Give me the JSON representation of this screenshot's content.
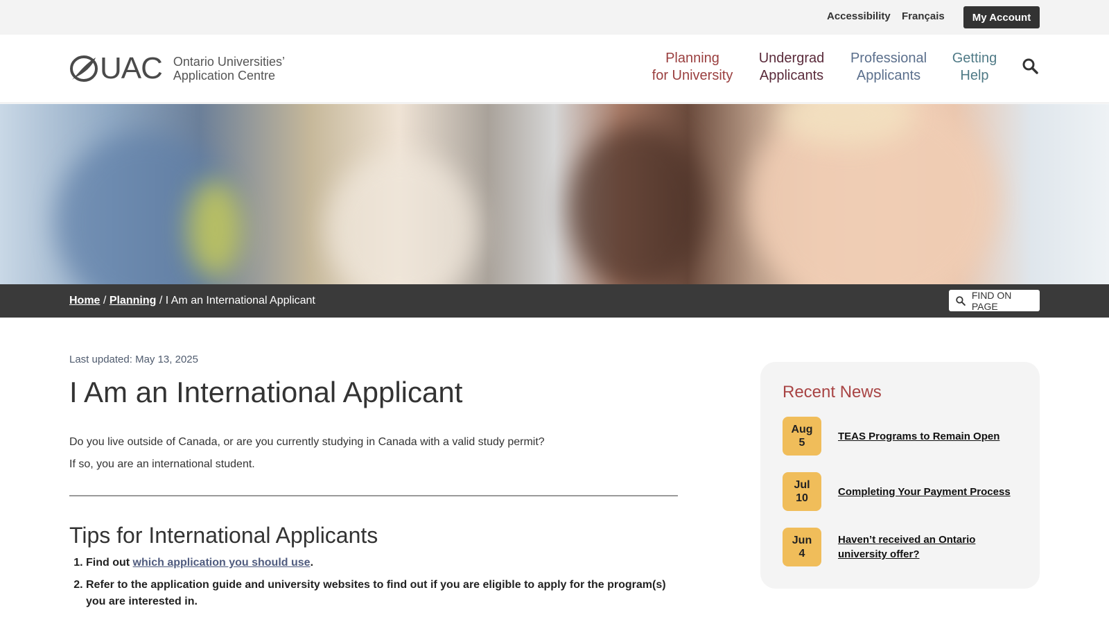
{
  "topbar": {
    "accessibility": "Accessibility",
    "french": "Français",
    "my_account": "My Account"
  },
  "logo": {
    "letters": "UAC",
    "line1": "Ontario Universities’",
    "line2": "Application Centre"
  },
  "nav": [
    {
      "line1": "Planning",
      "line2": "for University"
    },
    {
      "line1": "Undergrad",
      "line2": "Applicants"
    },
    {
      "line1": "Professional",
      "line2": "Applicants"
    },
    {
      "line1": "Getting",
      "line2": "Help"
    }
  ],
  "breadcrumb": {
    "home": "Home",
    "planning": "Planning",
    "sep": "/",
    "current": "I Am an International Applicant",
    "find_on_page": "FIND ON PAGE"
  },
  "main": {
    "last_updated": "Last updated: May 13, 2025",
    "title": "I Am an International Applicant",
    "intro": [
      "Do you live outside of Canada, or are you currently studying in Canada with a valid study permit?",
      "If so, you are an international student."
    ],
    "tips_heading": "Tips for International Applicants",
    "tip1_prefix": "Find out ",
    "tip1_link": "which application you should use",
    "tip1_suffix": ".",
    "tip2": "Refer to the application guide and university websites to find out if you are eligible to apply for the program(s) you are interested in."
  },
  "sidebar": {
    "heading": "Recent News",
    "items": [
      {
        "month": "Aug",
        "day": "5",
        "title": "TEAS Programs to Remain Open"
      },
      {
        "month": "Jul",
        "day": "10",
        "title": "Completing Your Payment Process"
      },
      {
        "month": "Jun",
        "day": "4",
        "title": "Haven’t received an Ontario university offer?"
      }
    ]
  },
  "colors": {
    "accent_red": "#a84444",
    "date_badge": "#f0bd5a",
    "dark_bar": "#3a3a3a"
  },
  "icons": [
    "search-icon",
    "uac-leaf-logo"
  ]
}
